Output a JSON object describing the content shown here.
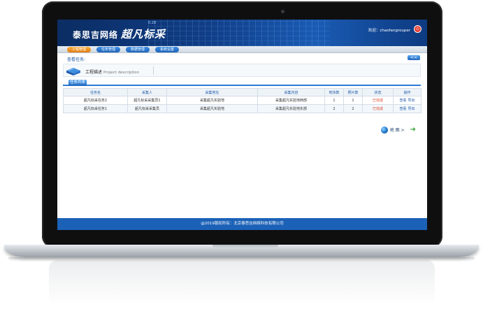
{
  "header": {
    "logo_small": "泰思吉网络",
    "logo_big": "超凡标采",
    "deco_number": "0.28",
    "welcome_label": "欢迎：",
    "username": "chaofangrouper",
    "power_icon": "power-icon"
  },
  "nav": {
    "tabs": [
      {
        "label": "工程管理",
        "active": true
      },
      {
        "label": "任务管理",
        "active": false
      },
      {
        "label": "数据管理",
        "active": false
      },
      {
        "label": "系统设置",
        "active": false
      }
    ]
  },
  "subheader": {
    "title": "查看任务:",
    "back_label": "<<"
  },
  "project": {
    "label_cn": "工程描述",
    "label_en": "Project description"
  },
  "task_list": {
    "tab_label": "任务列表",
    "columns": [
      "任务名",
      "采集人",
      "采集地址",
      "采集内容",
      "地块数",
      "照片数",
      "状态",
      "操作"
    ],
    "rows": [
      {
        "name": "超凡标采任务2",
        "collector": "超凡标采采集员1",
        "address": "采集超凡实验地",
        "content": "采集超凡实验地西部",
        "plots": "1",
        "photos": "1",
        "status": "已完成",
        "view": "查看",
        "export": "导出"
      },
      {
        "name": "超凡标采任务1",
        "collector": "超凡标采采集员",
        "address": "采集超凡实验地",
        "content": "采集超凡实验地东部",
        "plots": "2",
        "photos": "2",
        "status": "已完成",
        "view": "查看",
        "export": "导出"
      }
    ]
  },
  "map_link": {
    "label": "地 图 >",
    "globe_icon": "globe-icon",
    "arrow_icon": "arrow-right-icon"
  },
  "footer": {
    "copyright": "@2019版权所有：北京泰思吉网络科技有限公司"
  },
  "colors": {
    "banner": "#103d86",
    "accent": "#1f63b6",
    "active_tab": "#e37a12",
    "status": "#e0442c",
    "footer": "#1b61b7"
  }
}
